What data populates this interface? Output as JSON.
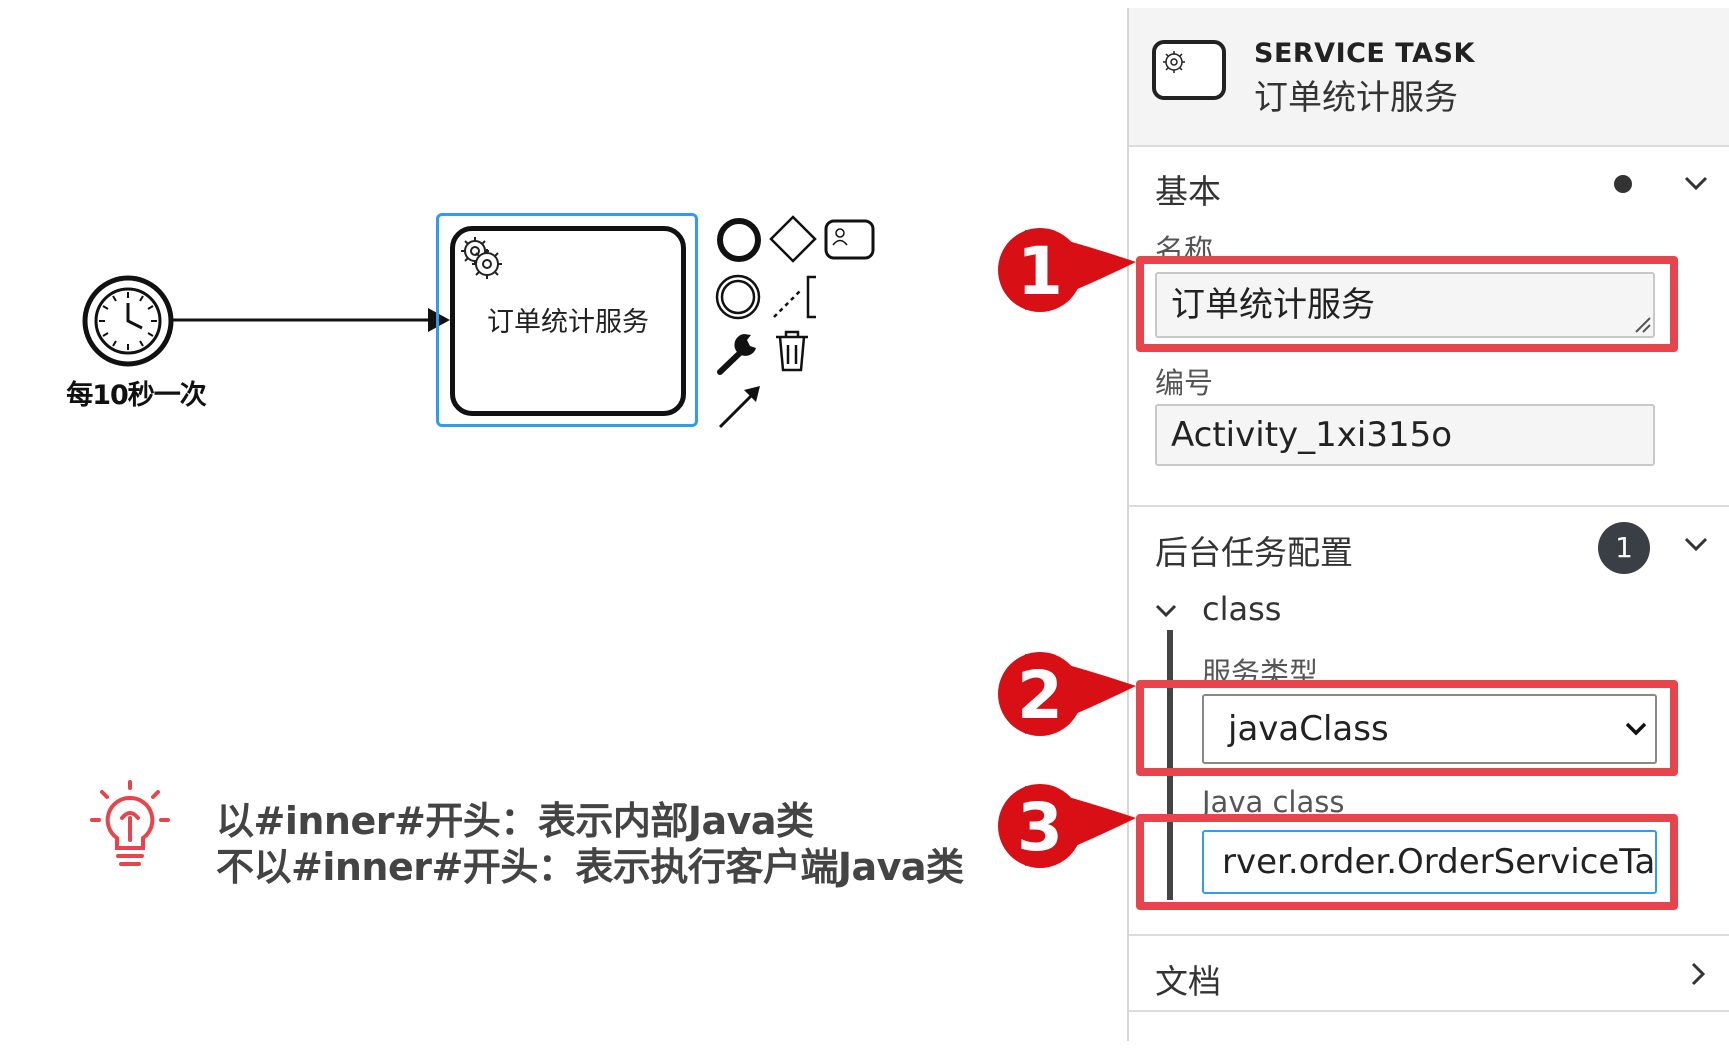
{
  "diagram": {
    "timer_label": "每10秒一次",
    "task_label": "订单统计服务"
  },
  "tip": {
    "line1": "以#inner#开头：表示内部Java类",
    "line2": "不以#inner#开头：表示执行客户端Java类"
  },
  "panel": {
    "header_type": "SERVICE TASK",
    "header_name": "订单统计服务",
    "basic_group": {
      "title": "基本",
      "name_label": "名称",
      "name_value": "订单统计服务",
      "id_label": "编号",
      "id_value": "Activity_1xi315o"
    },
    "async_group": {
      "title": "后台任务配置",
      "badge": "1",
      "sub_title": "class",
      "service_type_label": "服务类型",
      "service_type_value": "javaClass",
      "java_class_label": "Java class",
      "java_class_value": "rver.order.OrderServiceTask"
    },
    "doc_group": {
      "title": "文档"
    }
  },
  "callouts": [
    "1",
    "2",
    "3"
  ],
  "colors": {
    "selection": "#2f9cf0",
    "callout_red": "#e8444c",
    "bubble_red": "#d90f16"
  }
}
